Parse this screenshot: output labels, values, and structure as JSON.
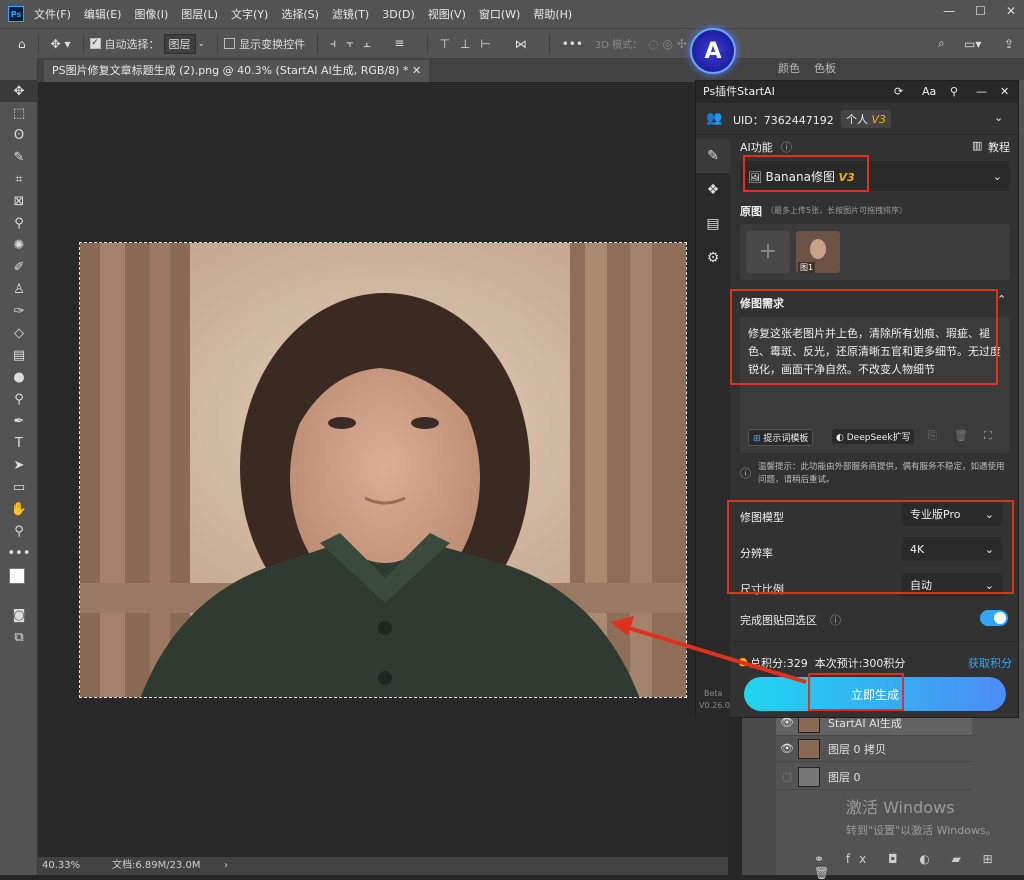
{
  "menu": {
    "items": [
      "文件(F)",
      "编辑(E)",
      "图像(I)",
      "图层(L)",
      "文字(Y)",
      "选择(S)",
      "滤镜(T)",
      "3D(D)",
      "视图(V)",
      "窗口(W)",
      "帮助(H)"
    ],
    "app_logo": "Ps"
  },
  "options": {
    "auto_select_label": "自动选择：",
    "auto_select_value": "图层",
    "show_transform_label": "显示变换控件",
    "mode3d": "3D 模式："
  },
  "document": {
    "tab_title": "PS图片修复文章标题生成 (2).png @ 40.3% (StartAI AI生成, RGB/8) *"
  },
  "status": {
    "zoom": "40.33%",
    "doc_size": "文档:6.89M/23.0M"
  },
  "right_tabs": [
    "颜色",
    "色板"
  ],
  "plugin": {
    "title": "Ps插件StartAI",
    "uid": "UID：7362447192",
    "account_type": "个人",
    "version_badge": "V3",
    "ai_function_label": "AI功能",
    "tutorial_label": "教程",
    "function_value": "Banana修图",
    "function_badge": "V3",
    "original_label": "原图",
    "original_hint": "（最多上传5张，长按图片可拖拽排序）",
    "thumb_caption": "图1",
    "requirement_label": "修图需求",
    "requirement_text": "修复这张老图片并上色，清除所有划痕、瑕疵、褪色、霉斑、反光，还原清晰五官和更多细节。无过度锐化，画面干净自然。不改变人物细节",
    "prompt_template_btn": "提示词模板",
    "deepseek_btn": "DeepSeek扩写",
    "notice": "温馨提示：此功能由外部服务商提供，偶有服务不稳定，如遇使用问题，请稍后重试。",
    "model_label": "修图模型",
    "model_value": "专业版Pro",
    "resolution_label": "分辨率",
    "resolution_value": "4K",
    "ratio_label": "尺寸比例",
    "ratio_value": "自动",
    "paste_back_label": "完成图贴回选区",
    "points_text": "总积分:329  本次预计:300积分",
    "get_points": "获取积分",
    "generate_btn": "立即生成",
    "beta": "Beta",
    "version": "V0.26.0"
  },
  "layers": [
    {
      "name": "StartAI AI生成"
    },
    {
      "name": "图层 0 拷贝"
    },
    {
      "name": "图层 0"
    }
  ],
  "watermark": {
    "line1": "激活 Windows",
    "line2": "转到\"设置\"以激活 Windows。"
  },
  "colors": {
    "accent": "#31a8ff",
    "highlight": "#e0301e",
    "generate_gradient_start": "#1ed6f0",
    "generate_gradient_end": "#4c8cf5",
    "badge": "#f5b400"
  }
}
